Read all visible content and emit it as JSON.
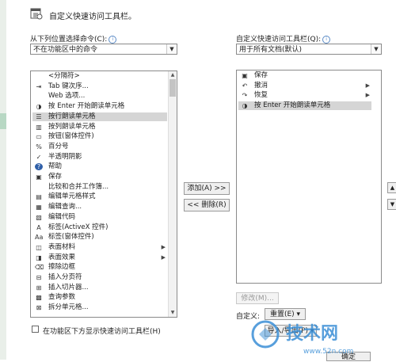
{
  "header": {
    "title": "自定义快速访问工具栏。"
  },
  "left": {
    "choose_label": "从下列位置选择命令(C):",
    "choose_value": "不在功能区中的命令",
    "items": [
      {
        "label": "<分隔符>",
        "icon": ""
      },
      {
        "label": "Tab 键次序...",
        "icon": "tab-order-icon"
      },
      {
        "label": "Web 选项...",
        "icon": ""
      },
      {
        "label": "按 Enter 开始朗读单元格",
        "icon": "speak-enter-icon"
      },
      {
        "label": "按行朗读单元格",
        "icon": "speak-rows-icon",
        "selected": true
      },
      {
        "label": "按列朗读单元格",
        "icon": "speak-columns-icon"
      },
      {
        "label": "按钮(窗体控件)",
        "icon": "button-control-icon"
      },
      {
        "label": "百分号",
        "icon": "percent-icon"
      },
      {
        "label": "半透明阴影",
        "icon": "shadow-icon"
      },
      {
        "label": "帮助",
        "icon": "help-icon"
      },
      {
        "label": "保存",
        "icon": "save-icon"
      },
      {
        "label": "比较和合并工作簿...",
        "icon": ""
      },
      {
        "label": "编辑单元格样式",
        "icon": "cell-style-icon"
      },
      {
        "label": "编辑查询...",
        "icon": "edit-query-icon"
      },
      {
        "label": "编辑代码",
        "icon": "code-icon"
      },
      {
        "label": "标签(ActiveX 控件)",
        "icon": "label-activex-icon"
      },
      {
        "label": "标签(窗体控件)",
        "icon": "label-form-icon"
      },
      {
        "label": "表面材料",
        "icon": "surface-material-icon",
        "arrow": true
      },
      {
        "label": "表面效果",
        "icon": "surface-effect-icon",
        "arrow": true
      },
      {
        "label": "擦除边框",
        "icon": "eraser-icon"
      },
      {
        "label": "插入分页符",
        "icon": "page-break-icon"
      },
      {
        "label": "插入切片器...",
        "icon": "slicer-icon"
      },
      {
        "label": "查询参数",
        "icon": "query-params-icon"
      },
      {
        "label": "拆分单元格...",
        "icon": "split-cells-icon"
      }
    ],
    "show_below_label": "在功能区下方显示快速访问工具栏(H)"
  },
  "middle": {
    "add_label": "添加(A) >>",
    "remove_label": "<< 删除(R)"
  },
  "right": {
    "customize_label": "自定义快速访问工具栏(Q):",
    "customize_value": "用于所有文档(默认)",
    "items": [
      {
        "label": "保存",
        "icon": "save-icon"
      },
      {
        "label": "撤消",
        "icon": "undo-icon",
        "arrow": true
      },
      {
        "label": "恢复",
        "icon": "redo-icon",
        "arrow": true
      },
      {
        "label": "按 Enter 开始朗读单元格",
        "icon": "speak-enter-icon",
        "selected": true
      }
    ],
    "modify_label": "修改(M)...",
    "custom_label": "自定义:",
    "reset_label": "重置(E) ▾",
    "import_export_label": "导入/导出(P) ▾",
    "ok_label": "确定"
  },
  "watermark": {
    "text": "技术网",
    "url": "www.52n.com"
  },
  "colors": {
    "selection": "#d5d5d5",
    "watermark": "#3b8fd6"
  }
}
